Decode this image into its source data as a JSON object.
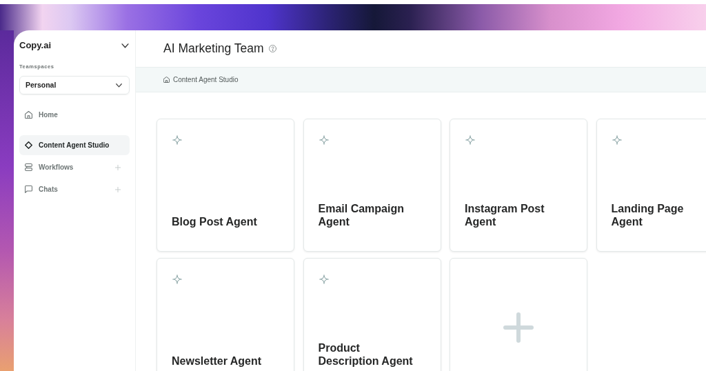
{
  "sidebar": {
    "workspace": "Copy.ai",
    "section_label": "Teamspaces",
    "teamspace": "Personal",
    "groups": [
      {
        "items": [
          {
            "label": "Home",
            "selected": false,
            "kind": "link"
          }
        ]
      },
      {
        "items": [
          {
            "label": "Content Agent Studio",
            "selected": true,
            "kind": "link"
          },
          {
            "label": "Workflows",
            "selected": false,
            "kind": "addable"
          },
          {
            "label": "Chats",
            "selected": false,
            "kind": "addable"
          }
        ]
      }
    ]
  },
  "header": {
    "title": "AI Marketing Team"
  },
  "breadcrumb": {
    "label": "Content Agent Studio"
  },
  "cards": [
    {
      "kind": "agent",
      "title": "Blog Post Agent"
    },
    {
      "kind": "agent",
      "title": "Email Campaign Agent"
    },
    {
      "kind": "agent",
      "title": "Instagram Post Agent"
    },
    {
      "kind": "agent",
      "title": "Landing Page Agent"
    },
    {
      "kind": "agent",
      "title": "Newsletter Agent"
    },
    {
      "kind": "agent",
      "title": "Product Description Agent"
    },
    {
      "kind": "add"
    }
  ]
}
